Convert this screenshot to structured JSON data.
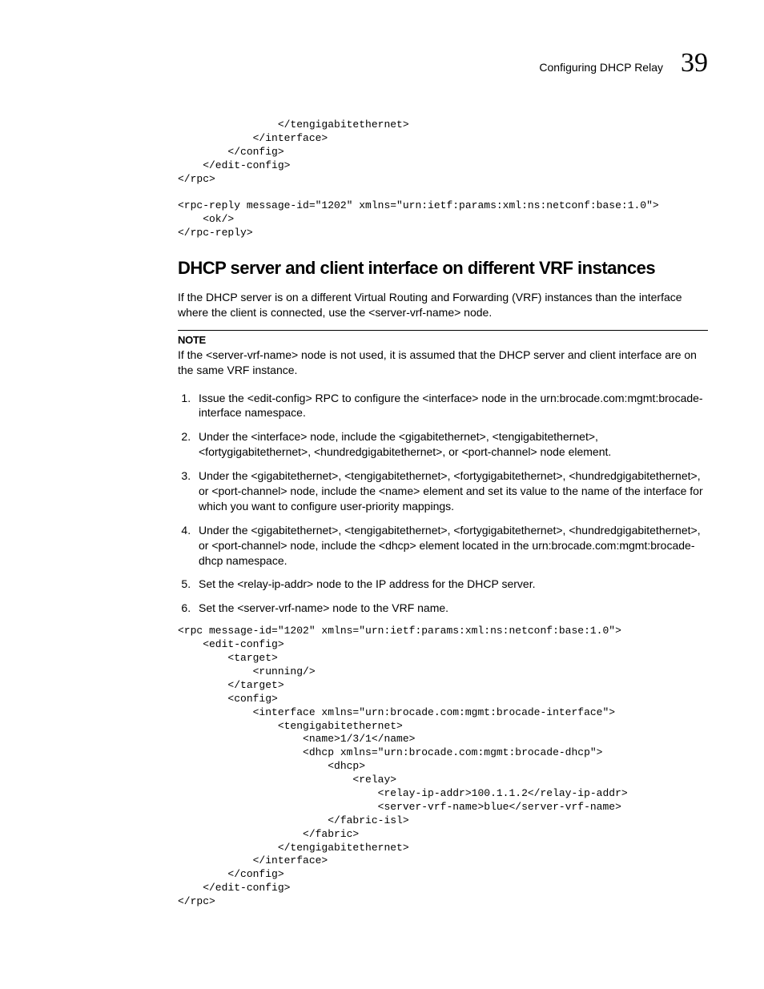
{
  "header": {
    "title": "Configuring DHCP Relay",
    "chapter": "39"
  },
  "code1": "                </tengigabitethernet>\n            </interface>\n        </config>\n    </edit-config>\n</rpc>\n\n<rpc-reply message-id=\"1202\" xmlns=\"urn:ietf:params:xml:ns:netconf:base:1.0\">\n    <ok/>\n</rpc-reply>",
  "section": {
    "title": "DHCP server and client interface on different VRF instances",
    "intro": "If the DHCP server is on a different Virtual Routing and Forwarding (VRF) instances than the interface where the client is connected, use the <server-vrf-name> node."
  },
  "note": {
    "label": "NOTE",
    "text": "If the <server-vrf-name> node is not used, it is assumed that the DHCP server and client interface are on the same VRF instance."
  },
  "steps": [
    "Issue the <edit-config> RPC to configure the <interface> node in the urn:brocade.com:mgmt:brocade-interface namespace.",
    "Under the <interface> node, include the <gigabitethernet>, <tengigabitethernet>, <fortygigabitethernet>, <hundredgigabitethernet>, or <port-channel> node element.",
    "Under the <gigabitethernet>, <tengigabitethernet>, <fortygigabitethernet>, <hundredgigabitethernet>, or <port-channel> node, include the <name> element and set its value to the name of the interface for which you want to configure user-priority mappings.",
    "Under the <gigabitethernet>, <tengigabitethernet>, <fortygigabitethernet>, <hundredgigabitethernet>, or <port-channel> node, include the <dhcp> element located in the urn:brocade.com:mgmt:brocade-dhcp namespace.",
    "Set the <relay-ip-addr> node to the IP address for the DHCP server.",
    "Set the <server-vrf-name> node to the VRF name."
  ],
  "code2": "<rpc message-id=\"1202\" xmlns=\"urn:ietf:params:xml:ns:netconf:base:1.0\">\n    <edit-config>\n        <target>\n            <running/>\n        </target>\n        <config>\n            <interface xmlns=\"urn:brocade.com:mgmt:brocade-interface\">\n                <tengigabitethernet>\n                    <name>1/3/1</name>\n                    <dhcp xmlns=\"urn:brocade.com:mgmt:brocade-dhcp\">\n                        <dhcp>\n                            <relay>\n                                <relay-ip-addr>100.1.1.2</relay-ip-addr>\n                                <server-vrf-name>blue</server-vrf-name>\n                        </fabric-isl>\n                    </fabric>\n                </tengigabitethernet>\n            </interface>\n        </config>\n    </edit-config>\n</rpc>"
}
